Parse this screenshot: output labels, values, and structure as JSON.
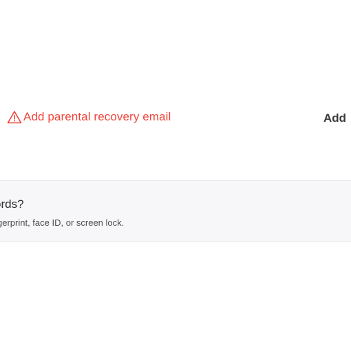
{
  "recovery": {
    "warning_label": "Add parental recovery email",
    "add_label": "Add",
    "warning_color": "#f0443a",
    "icon": "warning-triangle-icon"
  },
  "info": {
    "title": "ords?",
    "description": "gerprint, face ID, or screen lock."
  }
}
